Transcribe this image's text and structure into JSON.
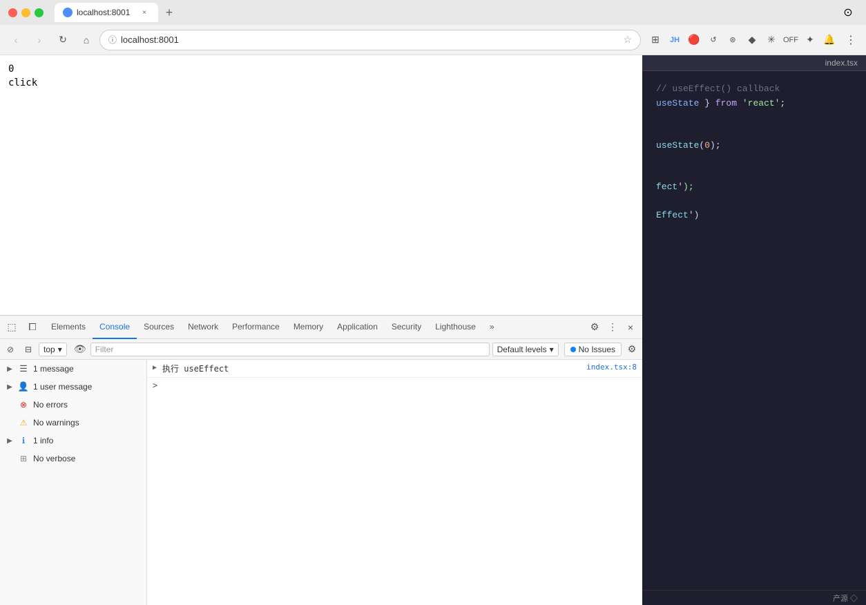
{
  "titlebar": {
    "tab": {
      "favicon_color": "#4e8ef7",
      "title": "localhost:8001",
      "close_label": "×"
    },
    "new_tab_label": "+",
    "menu_icon": "⊙"
  },
  "navbar": {
    "back_label": "‹",
    "forward_label": "›",
    "reload_label": "↻",
    "home_label": "⌂",
    "url": "localhost:8001",
    "star_label": "☆",
    "extensions": [
      "JH",
      "🔴",
      "↺",
      "⊞",
      "♦",
      "🔷",
      "⚙️",
      "❋",
      "🔔",
      "⋮"
    ],
    "more_label": "⋮"
  },
  "page": {
    "counter": "0",
    "click": "click"
  },
  "devtools": {
    "tabs": [
      {
        "label": "Elements",
        "active": false
      },
      {
        "label": "Console",
        "active": true
      },
      {
        "label": "Sources",
        "active": false
      },
      {
        "label": "Network",
        "active": false
      },
      {
        "label": "Performance",
        "active": false
      },
      {
        "label": "Memory",
        "active": false
      },
      {
        "label": "Application",
        "active": false
      },
      {
        "label": "Security",
        "active": false
      },
      {
        "label": "Lighthouse",
        "active": false
      }
    ],
    "more_tabs_label": "»",
    "settings_label": "⚙",
    "more_label": "⋮",
    "close_label": "×"
  },
  "console_toolbar": {
    "clear_label": "🚫",
    "context": "top",
    "filter_placeholder": "Filter",
    "levels_label": "Default levels",
    "no_issues_label": "No Issues",
    "settings_label": "⚙"
  },
  "console_sidebar": {
    "items": [
      {
        "label": "1 message",
        "icon": "messages",
        "badge": null,
        "expandable": true
      },
      {
        "label": "1 user message",
        "icon": "user",
        "badge": null,
        "expandable": true
      },
      {
        "label": "No errors",
        "icon": "error",
        "badge": null,
        "expandable": false
      },
      {
        "label": "No warnings",
        "icon": "warning",
        "badge": null,
        "expandable": false
      },
      {
        "label": "1 info",
        "icon": "info",
        "badge": null,
        "expandable": true
      },
      {
        "label": "No verbose",
        "icon": "verbose",
        "badge": null,
        "expandable": false
      }
    ]
  },
  "console_log": {
    "entry": {
      "text": "执行 useEffect",
      "source": "index.tsx:8"
    },
    "caret": ">"
  },
  "editor": {
    "title": "index.tsx",
    "lines": [
      {
        "text": "useEffect() callback",
        "class": "c-comment",
        "prefix": "// "
      },
      {
        "text": "useState } from 'react';",
        "class": "mixed"
      },
      {
        "text": ""
      },
      {
        "text": ""
      },
      {
        "text": "useState(0);",
        "class": "mixed"
      },
      {
        "text": ""
      },
      {
        "text": ""
      },
      {
        "text": "fect');",
        "class": "mixed"
      },
      {
        "text": ""
      },
      {
        "text": "Effect')",
        "class": "mixed"
      }
    ]
  },
  "bottom": {
    "source_label": "产源 ◇"
  }
}
